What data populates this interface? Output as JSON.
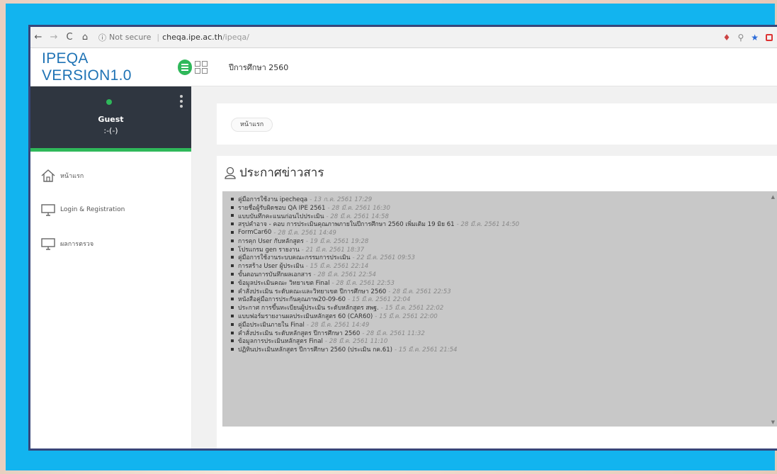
{
  "browser": {
    "security_label": "Not secure",
    "host": "cheqa.ipe.ac.th",
    "path": "/ipeqa/"
  },
  "header": {
    "brand": "IPEQA VERSION1.0",
    "academic_year": "ปีการศึกษา 2560"
  },
  "user": {
    "name": "Guest",
    "status": ":-(-)"
  },
  "sidebar": {
    "items": [
      {
        "label": "หน้าแรก",
        "icon": "home-icon"
      },
      {
        "label": "Login & Registration",
        "icon": "monitor-icon"
      },
      {
        "label": "ผลการตรวจ",
        "icon": "monitor-icon"
      }
    ]
  },
  "breadcrumb": {
    "label": "หน้าแรก"
  },
  "news": {
    "title": "ประกาศข่าวสาร",
    "items": [
      {
        "text": "คู่มือการใช้งาน ipecheqa",
        "date": "- 13 ก.ค. 2561 17:29"
      },
      {
        "text": "รายชื่อผู้รับผิดชอบ QA IPE 2561",
        "date": "- 28 มี.ค. 2561 16:30"
      },
      {
        "text": "แบบบันทึกคะแนนก่อนไปประเมิน",
        "date": "- 28 มี.ค. 2561 14:58"
      },
      {
        "text": "สรุปคำอาจ - คอบ การประเมินคุณภาพภายในปีการศึกษา 2560 เพิ่มเติม 19 มิย 61",
        "date": "- 28 มี.ค. 2561 14:50"
      },
      {
        "text": "FormCar60",
        "date": "- 28 มี.ค. 2561 14:49"
      },
      {
        "text": "การคุก User กับหลักสูตร",
        "date": "- 19 มี.ค. 2561 19:28"
      },
      {
        "text": "โปรแกรม gen รายงาน",
        "date": "- 21 มี.ค. 2561 18:37"
      },
      {
        "text": "คู่มือการใช้งานระบบคณะกรรมการประเมิน",
        "date": "- 22 มี.ค. 2561 09:53"
      },
      {
        "text": "การสร้าง User ผู้ประเมิน",
        "date": "- 15 มี.ค. 2561 22:14"
      },
      {
        "text": "ขั้นตอนการบันทึกผลเอกสาร",
        "date": "- 28 มี.ค. 2561 22:54"
      },
      {
        "text": "ข้อมูลประเมินคณะ วิทยาเขต Final",
        "date": "- 28 มี.ค. 2561 22:53"
      },
      {
        "text": "คำสั่งประเมิน ระดับคณะและวิทยาเขต ปีการศึกษา 2560",
        "date": "- 28 มี.ค. 2561 22:53"
      },
      {
        "text": "หนังสือคู่มือการประกันคุณภาพ20-09-60",
        "date": "- 15 มี.ค. 2561 22:04"
      },
      {
        "text": "ประกาศ การขึ้นทะเบียนผู้ประเมิน ระดับหลักสูตร สพฐ.",
        "date": "- 15 มี.ค. 2561 22:02"
      },
      {
        "text": "แบบฟอร์มรายงานผลประเมินหลักสูตร 60 (CAR60)",
        "date": "- 15 มี.ค. 2561 22:00"
      },
      {
        "text": "คู่มือประเมินภายใน Final",
        "date": "- 28 มี.ค. 2561 14:49"
      },
      {
        "text": "คำสั่งประเมิน ระดับหลักสูตร ปีการศึกษา 2560",
        "date": "- 28 มี.ค. 2561 11:32"
      },
      {
        "text": "ข้อมูลการประเมินหลักสูตร Final",
        "date": "- 28 มี.ค. 2561 11:10"
      },
      {
        "text": "ปฏิทินประเมินหลักสูตร ปีการศึกษา 2560 (ประเมิน กค.61)",
        "date": "- 15 มี.ค. 2561 21:54"
      }
    ]
  }
}
